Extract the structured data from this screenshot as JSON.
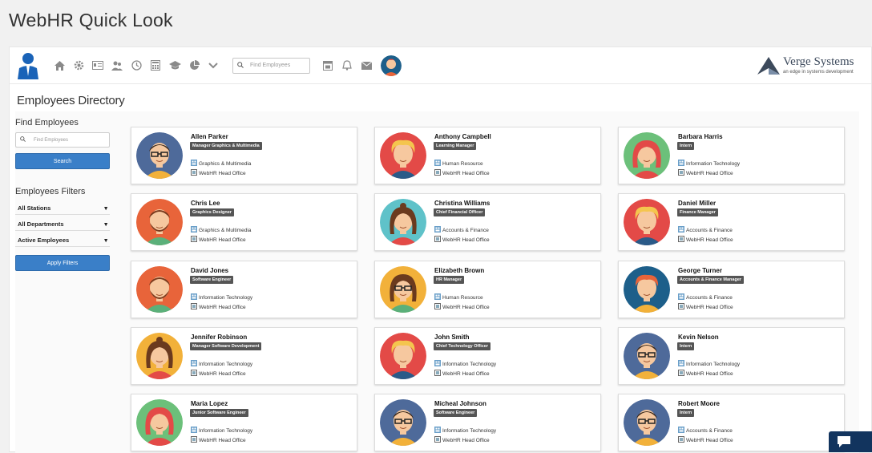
{
  "window_title": "WebHR Quick Look",
  "navbar": {
    "search_placeholder": "Find Employees",
    "brand_name": "Verge Systems",
    "brand_tagline": "an edge in systems development"
  },
  "page_title": "Employees Directory",
  "sidebar": {
    "find_heading": "Find Employees",
    "find_placeholder": "Find Employees",
    "search_label": "Search",
    "filters_heading": "Employees Filters",
    "station_filter": "All Stations",
    "department_filter": "All Departments",
    "status_filter": "Active Employees",
    "apply_label": "Apply Filters"
  },
  "employees": [
    {
      "name": "Allen Parker",
      "role": "Manager Graphics & Multimedia",
      "department": "Graphics & Multimedia",
      "office": "WebHR Head Office",
      "avatar": "man-glasses",
      "bg": "#4e6a9a"
    },
    {
      "name": "Anthony Campbell",
      "role": "Learning Manager",
      "department": "Human Resource",
      "office": "WebHR Head Office",
      "avatar": "man-blond",
      "bg": "#e34a47"
    },
    {
      "name": "Barbara Harris",
      "role": "Intern",
      "department": "Information Technology",
      "office": "WebHR Head Office",
      "avatar": "woman-red",
      "bg": "#6cc07a"
    },
    {
      "name": "Chris Lee",
      "role": "Graphics Designer",
      "department": "Graphics & Multimedia",
      "office": "WebHR Head Office",
      "avatar": "man-beard",
      "bg": "#e8643a"
    },
    {
      "name": "Christina Williams",
      "role": "Chief Financial Officer",
      "department": "Accounts & Finance",
      "office": "WebHR Head Office",
      "avatar": "woman-brown",
      "bg": "#5fc2c9"
    },
    {
      "name": "Daniel Miller",
      "role": "Finance Manager",
      "department": "Accounts & Finance",
      "office": "WebHR Head Office",
      "avatar": "man-blond",
      "bg": "#e34a47"
    },
    {
      "name": "David Jones",
      "role": "Software Engineer",
      "department": "Information Technology",
      "office": "WebHR Head Office",
      "avatar": "man-beard",
      "bg": "#e8643a"
    },
    {
      "name": "Elizabeth Brown",
      "role": "HR Manager",
      "department": "Human Resource",
      "office": "WebHR Head Office",
      "avatar": "woman-glasses",
      "bg": "#f2b13a"
    },
    {
      "name": "George Turner",
      "role": "Accounts & Finance Manager",
      "department": "Accounts & Finance",
      "office": "WebHR Head Office",
      "avatar": "man-red",
      "bg": "#1d5f8a"
    },
    {
      "name": "Jennifer Robinson",
      "role": "Manager Software Development",
      "department": "Information Technology",
      "office": "WebHR Head Office",
      "avatar": "woman-brown",
      "bg": "#f2b13a"
    },
    {
      "name": "John Smith",
      "role": "Chief Technology Officer",
      "department": "Information Technology",
      "office": "WebHR Head Office",
      "avatar": "man-blond",
      "bg": "#e34a47"
    },
    {
      "name": "Kevin Nelson",
      "role": "Intern",
      "department": "Information Technology",
      "office": "WebHR Head Office",
      "avatar": "man-glasses",
      "bg": "#4e6a9a"
    },
    {
      "name": "Maria Lopez",
      "role": "Junior Software Engineer",
      "department": "Information Technology",
      "office": "WebHR Head Office",
      "avatar": "woman-red",
      "bg": "#6cc07a"
    },
    {
      "name": "Micheal Johnson",
      "role": "Software Engineer",
      "department": "Information Technology",
      "office": "WebHR Head Office",
      "avatar": "man-glasses",
      "bg": "#4e6a9a"
    },
    {
      "name": "Robert Moore",
      "role": "Intern",
      "department": "Accounts & Finance",
      "office": "WebHR Head Office",
      "avatar": "man-glasses",
      "bg": "#4e6a9a"
    }
  ],
  "colors": {
    "accent": "#3a7fc8",
    "badge": "#555555",
    "chat": "#12345e"
  }
}
